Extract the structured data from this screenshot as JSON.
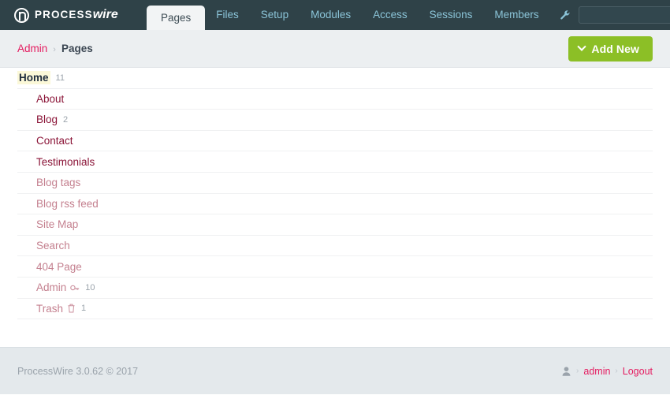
{
  "masthead": {
    "logo": {
      "process": "Process",
      "wire": "wire",
      "mark": "circled-p-logo"
    },
    "nav": [
      {
        "label": "Pages",
        "active": true
      },
      {
        "label": "Files",
        "active": false
      },
      {
        "label": "Setup",
        "active": false
      },
      {
        "label": "Modules",
        "active": false
      },
      {
        "label": "Access",
        "active": false
      },
      {
        "label": "Sessions",
        "active": false
      },
      {
        "label": "Members",
        "active": false
      }
    ],
    "tools_icon": "wrench-icon",
    "search": {
      "value": "",
      "placeholder": "",
      "icon": "search-icon"
    }
  },
  "breadcrumb": {
    "parent": "Admin",
    "separator": "›",
    "current": "Pages"
  },
  "toolbar": {
    "add_new_label": "Add New",
    "add_new_icon": "chevron-down-icon",
    "add_new_color": "#8cbf26"
  },
  "tree": {
    "rows": [
      {
        "title": "Home",
        "count": "11",
        "style": "root",
        "indent": 0,
        "icon": ""
      },
      {
        "title": "About",
        "count": "",
        "style": "normal",
        "indent": 1,
        "icon": ""
      },
      {
        "title": "Blog",
        "count": "2",
        "style": "normal",
        "indent": 1,
        "icon": ""
      },
      {
        "title": "Contact",
        "count": "",
        "style": "normal",
        "indent": 1,
        "icon": ""
      },
      {
        "title": "Testimonials",
        "count": "",
        "style": "normal",
        "indent": 1,
        "icon": ""
      },
      {
        "title": "Blog tags",
        "count": "",
        "style": "dim",
        "indent": 1,
        "icon": ""
      },
      {
        "title": "Blog rss feed",
        "count": "",
        "style": "dim",
        "indent": 1,
        "icon": ""
      },
      {
        "title": "Site Map",
        "count": "",
        "style": "dim",
        "indent": 1,
        "icon": ""
      },
      {
        "title": "Search",
        "count": "",
        "style": "dim",
        "indent": 1,
        "icon": ""
      },
      {
        "title": "404 Page",
        "count": "",
        "style": "dim",
        "indent": 1,
        "icon": ""
      },
      {
        "title": "Admin",
        "count": "10",
        "style": "dim",
        "indent": 1,
        "icon": "key-icon"
      },
      {
        "title": "Trash",
        "count": "1",
        "style": "dim",
        "indent": 1,
        "icon": "trash-icon"
      }
    ]
  },
  "footer": {
    "copyright": "ProcessWire 3.0.62 © 2017",
    "user_icon": "user-icon",
    "separator": "›",
    "user": "admin",
    "logout": "Logout"
  },
  "colors": {
    "masthead_bg": "#2f4248",
    "nav_link": "#8bc4d8",
    "accent_pink": "#e41c60",
    "link_crimson": "#8b1538",
    "link_dim": "#c4808f",
    "green": "#8cbf26",
    "highlight_yellow": "#fbf8d8"
  }
}
